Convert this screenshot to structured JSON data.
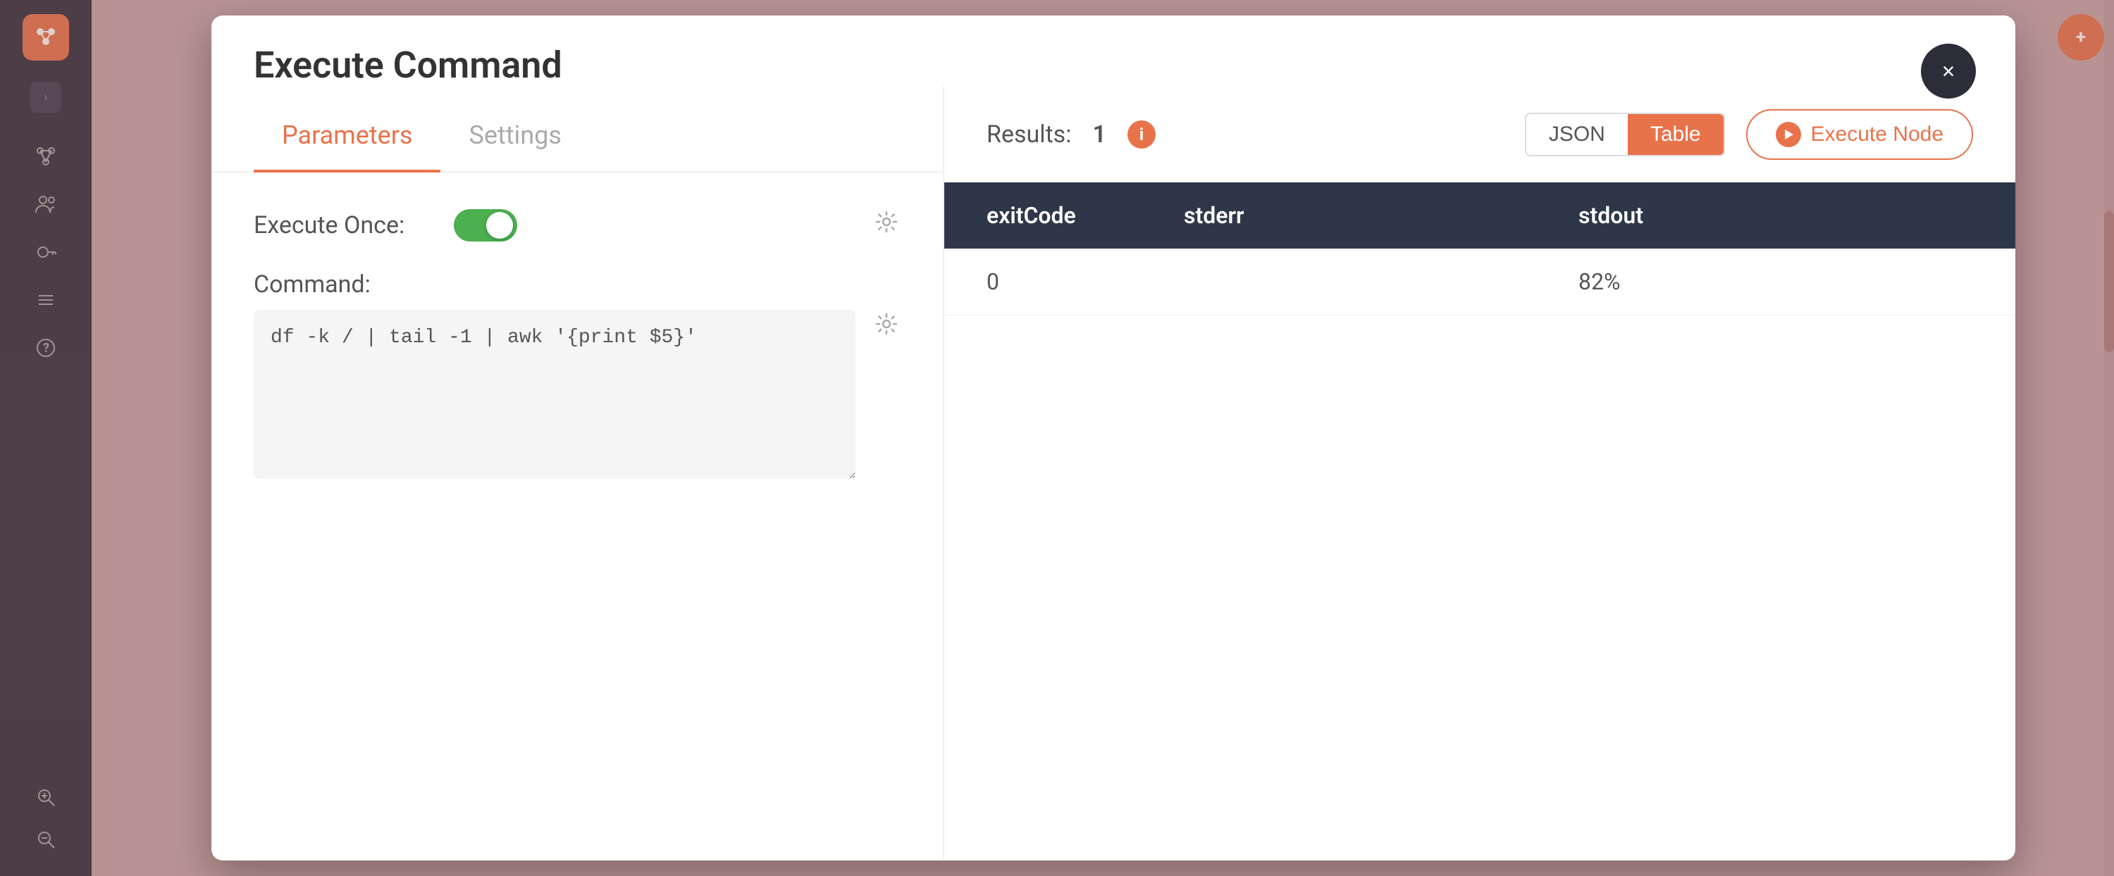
{
  "sidebar": {
    "logo_icon": "⬡",
    "toggle_icon": "›",
    "icons": [
      {
        "name": "nodes-icon",
        "symbol": "⬡"
      },
      {
        "name": "users-icon",
        "symbol": "👥"
      },
      {
        "name": "key-icon",
        "symbol": "🔑"
      },
      {
        "name": "list-icon",
        "symbol": "☰"
      },
      {
        "name": "help-icon",
        "symbol": "?"
      }
    ],
    "zoom_in_icon": "⊕",
    "zoom_out_icon": "⊖"
  },
  "modal": {
    "title": "Execute Command",
    "close_label": "×",
    "tabs": [
      {
        "id": "parameters",
        "label": "Parameters",
        "active": true
      },
      {
        "id": "settings",
        "label": "Settings",
        "active": false
      }
    ],
    "parameters": {
      "execute_once_label": "Execute Once:",
      "command_label": "Command:",
      "command_value": "df -k / | tail -1 | awk '{print $5}'"
    }
  },
  "results": {
    "label": "Results:",
    "count": "1",
    "info_symbol": "i",
    "view_json_label": "JSON",
    "view_table_label": "Table",
    "execute_node_label": "Execute Node",
    "play_symbol": "▶",
    "table": {
      "headers": [
        "exitCode",
        "stderr",
        "stdout"
      ],
      "rows": [
        {
          "exitCode": "0",
          "stderr": "",
          "stdout": "82%"
        }
      ]
    }
  },
  "colors": {
    "accent": "#e8734a",
    "sidebar_bg": "#2d2d3a",
    "table_header_bg": "#2d3748",
    "active_tab_color": "#e8734a",
    "toggle_on_color": "#4caf50"
  }
}
